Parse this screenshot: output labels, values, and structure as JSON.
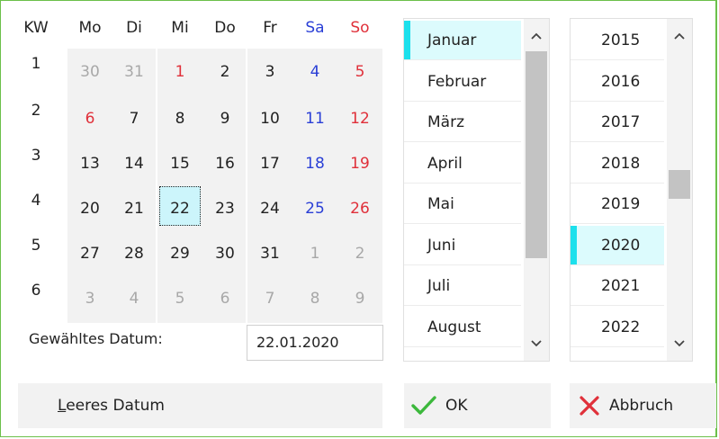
{
  "calendar": {
    "headers": [
      "KW",
      "Mo",
      "Di",
      "Mi",
      "Do",
      "Fr",
      "Sa",
      "So"
    ],
    "weeks": [
      {
        "kw": "1",
        "days": [
          [
            "30",
            "grey"
          ],
          [
            "31",
            "grey"
          ],
          [
            "1",
            "red"
          ],
          [
            "2",
            "blk"
          ],
          [
            "3",
            "blk"
          ],
          [
            "4",
            "blue"
          ],
          [
            "5",
            "red"
          ]
        ]
      },
      {
        "kw": "2",
        "days": [
          [
            "6",
            "red"
          ],
          [
            "7",
            "blk"
          ],
          [
            "8",
            "blk"
          ],
          [
            "9",
            "blk"
          ],
          [
            "10",
            "blk"
          ],
          [
            "11",
            "blue"
          ],
          [
            "12",
            "red"
          ]
        ]
      },
      {
        "kw": "3",
        "days": [
          [
            "13",
            "blk"
          ],
          [
            "14",
            "blk"
          ],
          [
            "15",
            "blk"
          ],
          [
            "16",
            "blk"
          ],
          [
            "17",
            "blk"
          ],
          [
            "18",
            "blue"
          ],
          [
            "19",
            "red"
          ]
        ]
      },
      {
        "kw": "4",
        "days": [
          [
            "20",
            "blk"
          ],
          [
            "21",
            "blk"
          ],
          [
            "22",
            "sel"
          ],
          [
            "23",
            "blk"
          ],
          [
            "24",
            "blk"
          ],
          [
            "25",
            "blue"
          ],
          [
            "26",
            "red"
          ]
        ]
      },
      {
        "kw": "5",
        "days": [
          [
            "27",
            "blk"
          ],
          [
            "28",
            "blk"
          ],
          [
            "29",
            "blk"
          ],
          [
            "30",
            "blk"
          ],
          [
            "31",
            "blk"
          ],
          [
            "1",
            "grey"
          ],
          [
            "2",
            "grey"
          ]
        ]
      },
      {
        "kw": "6",
        "days": [
          [
            "3",
            "grey"
          ],
          [
            "4",
            "grey"
          ],
          [
            "5",
            "grey"
          ],
          [
            "6",
            "grey"
          ],
          [
            "7",
            "grey"
          ],
          [
            "8",
            "grey"
          ],
          [
            "9",
            "grey"
          ]
        ]
      }
    ],
    "selected_label": "Gewähltes Datum:",
    "selected_value": "22.01.2020"
  },
  "months": {
    "items": [
      "Januar",
      "Februar",
      "März",
      "April",
      "Mai",
      "Juni",
      "Juli",
      "August"
    ],
    "active": "Januar",
    "scroll_up_icon": "chevron-up-icon",
    "scroll_down_icon": "chevron-down-icon"
  },
  "years": {
    "items": [
      "2015",
      "2016",
      "2017",
      "2018",
      "2019",
      "2020",
      "2021",
      "2022"
    ],
    "active": "2020"
  },
  "buttons": {
    "clear_underline": "L",
    "clear_rest": "eeres Datum",
    "ok_label": "OK",
    "cancel_label": "Abbruch"
  },
  "colors": {
    "accent_border": "#6cc04a",
    "selection_bg": "#dcfbfd",
    "selection_bar": "#1ce0ec",
    "weekend_sat": "#2a3fd6",
    "weekend_sun": "#e0303a",
    "ok_check": "#3cb83c",
    "cancel_x": "#e0303a"
  }
}
